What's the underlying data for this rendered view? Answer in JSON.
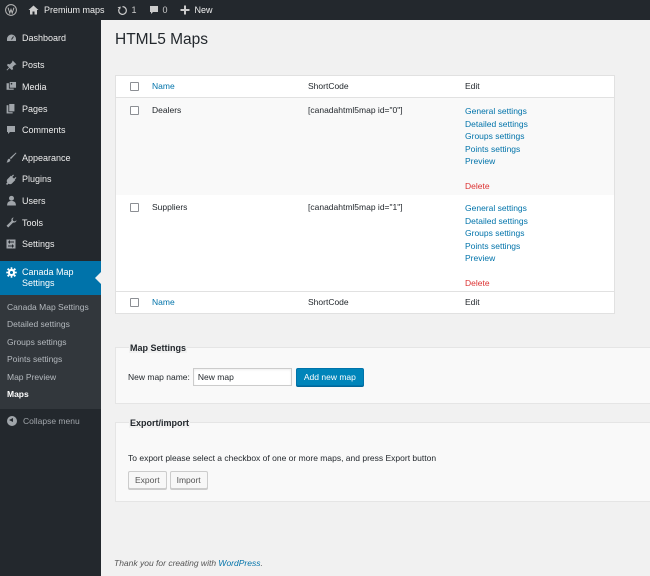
{
  "admin_bar": {
    "site_name": "Premium maps",
    "updates_count": "1",
    "comments_count": "0",
    "new_label": "New"
  },
  "sidebar": {
    "items": [
      {
        "label": "Dashboard",
        "icon": "dashboard-icon"
      },
      {
        "label": "Posts",
        "icon": "pushpin-icon"
      },
      {
        "label": "Media",
        "icon": "media-icon"
      },
      {
        "label": "Pages",
        "icon": "pages-icon"
      },
      {
        "label": "Comments",
        "icon": "comment-icon"
      },
      {
        "label": "Appearance",
        "icon": "paintbrush-icon"
      },
      {
        "label": "Plugins",
        "icon": "plug-icon"
      },
      {
        "label": "Users",
        "icon": "users-icon"
      },
      {
        "label": "Tools",
        "icon": "wrench-icon"
      },
      {
        "label": "Settings",
        "icon": "settings-icon"
      }
    ],
    "current": {
      "label_line1": "Canada Map",
      "label_line2": "Settings",
      "icon": "gear-icon"
    },
    "submenu": [
      "Canada Map Settings",
      "Detailed settings",
      "Groups settings",
      "Points settings",
      "Map Preview",
      "Maps"
    ],
    "collapse_label": "Collapse menu"
  },
  "page": {
    "title": "HTML5 Maps"
  },
  "table": {
    "headers": {
      "name": "Name",
      "shortcode": "ShortCode",
      "edit": "Edit"
    },
    "rows": [
      {
        "name": "Dealers",
        "shortcode": "[canadahtml5map id=\"0\"]",
        "links": [
          "General settings",
          "Detailed settings",
          "Groups settings",
          "Points settings",
          "Preview"
        ],
        "delete": "Delete"
      },
      {
        "name": "Suppliers",
        "shortcode": "[canadahtml5map id=\"1\"]",
        "links": [
          "General settings",
          "Detailed settings",
          "Groups settings",
          "Points settings",
          "Preview"
        ],
        "delete": "Delete"
      }
    ]
  },
  "map_settings": {
    "title": "Map Settings",
    "new_map_label": "New map name:",
    "new_map_value": "New map",
    "add_button": "Add new map"
  },
  "export_import": {
    "title": "Export/import",
    "description": "To export please select a checkbox of one or more maps, and press Export button",
    "export_button": "Export",
    "import_button": "Import"
  },
  "footer": {
    "text": "Thank you for creating with ",
    "link": "WordPress",
    "end": "."
  },
  "colors": {
    "accent": "#0073aa",
    "delete": "#dc3232",
    "sidebar_bg": "#23282d"
  }
}
